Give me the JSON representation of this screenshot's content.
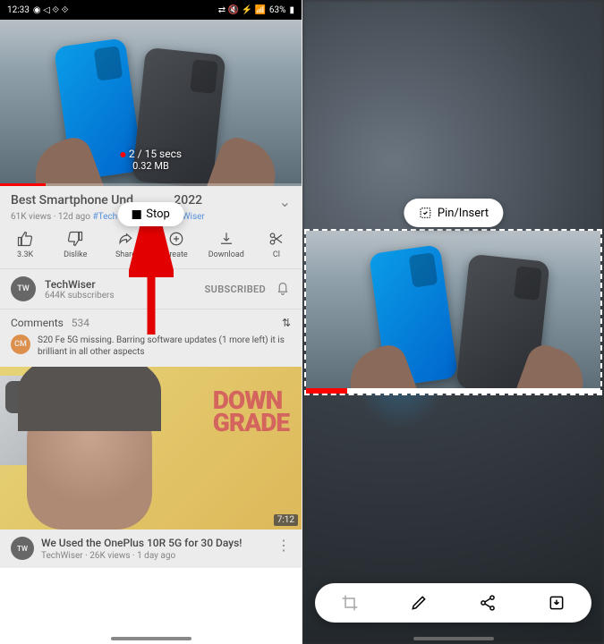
{
  "status": {
    "time": "12:33",
    "battery": "63%"
  },
  "record": {
    "time_elapsed": "2 / 15 secs",
    "size": "0.32 MB"
  },
  "stop_button": {
    "label": "Stop"
  },
  "video": {
    "title_pre": "Best Smartphone Und",
    "title_post": "2022",
    "views": "61K views",
    "age": "12d ago",
    "hashtags": [
      "#Tech",
      "#TeamTechWiser"
    ]
  },
  "actions": {
    "like": "3.3K",
    "dislike": "Dislike",
    "share": "Share",
    "create": "Create",
    "download": "Download",
    "clip": "Cl"
  },
  "channel": {
    "initials": "TW",
    "name": "TechWiser",
    "subs": "644K subscribers",
    "state": "SUBSCRIBED"
  },
  "comments": {
    "label": "Comments",
    "count": "534",
    "top": {
      "initials": "CM",
      "text": "S20 Fe 5G missing. Barring software updates (1 more left) it is brilliant in all other aspects"
    }
  },
  "next": {
    "overlay_line1": "DOWN",
    "overlay_line2": "GRADE",
    "duration": "7:12",
    "avatar": "TW",
    "title": "We Used the OnePlus 10R 5G for 30 Days!",
    "sub": "TechWiser · 26K views · 1 day ago"
  },
  "editor": {
    "pin_label": "Pin/Insert"
  }
}
